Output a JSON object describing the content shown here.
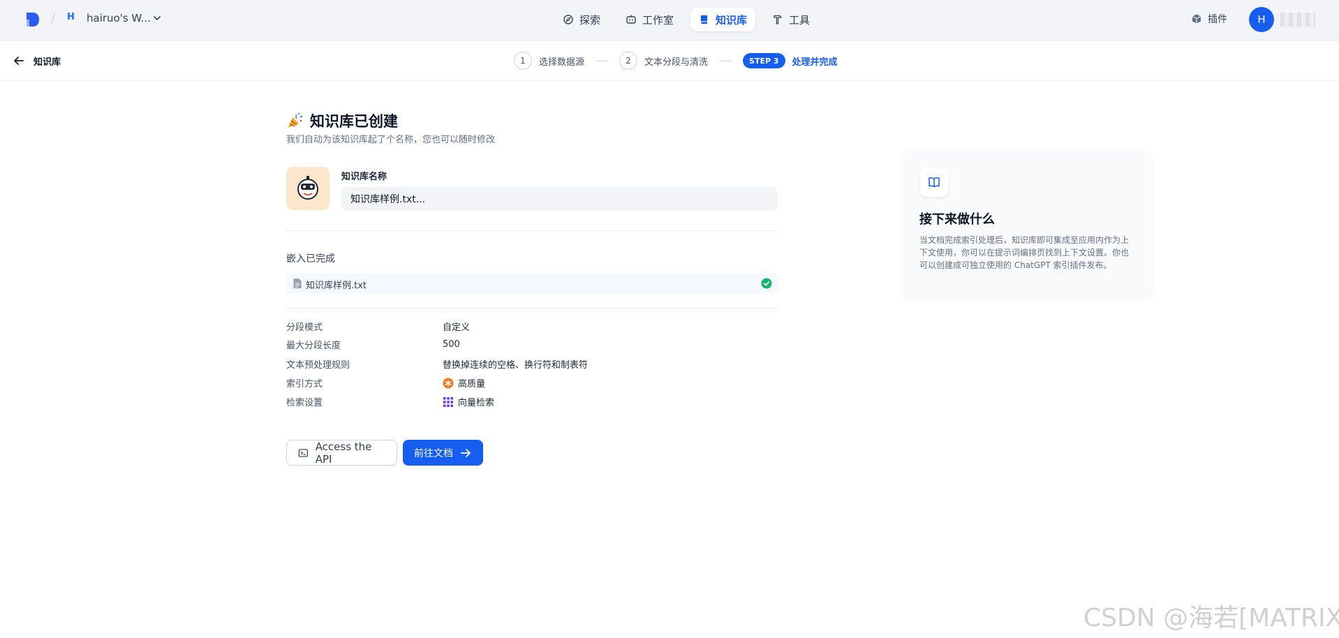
{
  "topnav": {
    "workspace_initial": "H",
    "workspace_name": "hairuo's W...",
    "items": [
      {
        "label": "探索",
        "icon": "compass-icon"
      },
      {
        "label": "工作室",
        "icon": "robot-icon"
      },
      {
        "label": "知识库",
        "icon": "book-icon",
        "active": true
      },
      {
        "label": "工具",
        "icon": "hammer-icon"
      }
    ],
    "plugin_label": "插件",
    "user_initial": "H"
  },
  "subheader": {
    "back_label": "知识库",
    "steps": [
      {
        "num": "1",
        "label": "选择数据源"
      },
      {
        "num": "2",
        "label": "文本分段与清洗"
      },
      {
        "badge": "STEP 3",
        "label": "处理并完成",
        "active": true
      }
    ]
  },
  "main": {
    "title": "知识库已创建",
    "subtitle": "我们自动为该知识库起了个名称，您也可以随时修改",
    "name_label": "知识库名称",
    "name_value": "知识库样例.txt...",
    "embed_title": "嵌入已完成",
    "file_name": "知识库样例.txt",
    "settings": [
      {
        "label": "分段模式",
        "value": "自定义"
      },
      {
        "label": "最大分段长度",
        "value": "500"
      },
      {
        "label": "文本预处理规则",
        "value": "替换掉连续的空格、换行符和制表符"
      },
      {
        "label": "索引方式",
        "value": "高质量",
        "icon": "star-badge-icon"
      },
      {
        "label": "检索设置",
        "value": "向量检索",
        "icon": "grid-icon"
      }
    ],
    "api_button": "Access the API",
    "docs_button": "前往文档"
  },
  "side": {
    "title": "接下来做什么",
    "description": "当文档完成索引处理后，知识库即可集成至应用内作为上下文使用，你可以在提示词编排页找到上下文设置。你也可以创建成可独立使用的 ChatGPT 索引插件发布。"
  },
  "watermark": "CSDN @海若[MATRIX]",
  "colors": {
    "accent": "#155eef",
    "success": "#12b76a",
    "orange": "#f97316",
    "purple": "#6938ef"
  }
}
